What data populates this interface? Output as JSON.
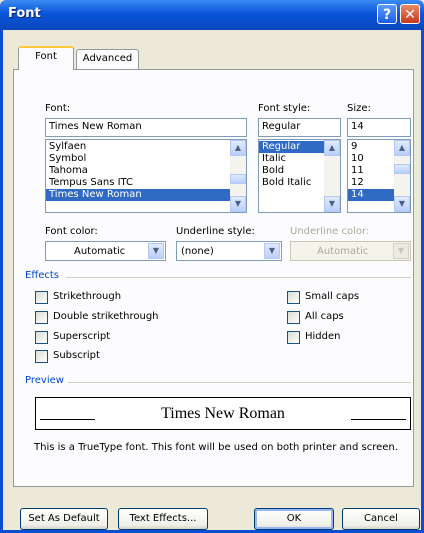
{
  "window": {
    "title": "Font",
    "help_glyph": "?",
    "close_glyph": "✕"
  },
  "tabs": [
    {
      "label": "Font"
    },
    {
      "label": "Advanced"
    }
  ],
  "font": {
    "label": "Font:",
    "value": "Times New Roman",
    "items": [
      "Sylfaen",
      "Symbol",
      "Tahoma",
      "Tempus Sans ITC",
      "Times New Roman"
    ],
    "selected": "Times New Roman"
  },
  "style": {
    "label": "Font style:",
    "value": "Regular",
    "items": [
      "Regular",
      "Italic",
      "Bold",
      "Bold Italic"
    ],
    "selected": "Regular"
  },
  "size": {
    "label": "Size:",
    "value": "14",
    "items": [
      "9",
      "10",
      "11",
      "12",
      "14"
    ],
    "selected": "14"
  },
  "font_color": {
    "label": "Font color:",
    "value": "Automatic"
  },
  "underline_style": {
    "label": "Underline style:",
    "value": "(none)"
  },
  "underline_color": {
    "label": "Underline color:",
    "value": "Automatic",
    "enabled": false
  },
  "effects": {
    "title": "Effects",
    "left": [
      {
        "label": "Strikethrough",
        "checked": false
      },
      {
        "label": "Double strikethrough",
        "checked": false
      },
      {
        "label": "Superscript",
        "checked": false
      },
      {
        "label": "Subscript",
        "checked": false
      }
    ],
    "right": [
      {
        "label": "Small caps",
        "checked": false
      },
      {
        "label": "All caps",
        "checked": false
      },
      {
        "label": "Hidden",
        "checked": false
      }
    ]
  },
  "preview": {
    "title": "Preview",
    "sample": "Times New Roman",
    "description": "This is a TrueType font. This font will be used on both printer and screen."
  },
  "buttons": {
    "set_default": "Set As Default",
    "text_effects": "Text Effects...",
    "ok": "OK",
    "cancel": "Cancel"
  },
  "colors": {
    "title_bar": "#0A54D8",
    "dialog_bg": "#ECE9D8",
    "selection": "#316AC5",
    "group_title": "#0046D5"
  }
}
